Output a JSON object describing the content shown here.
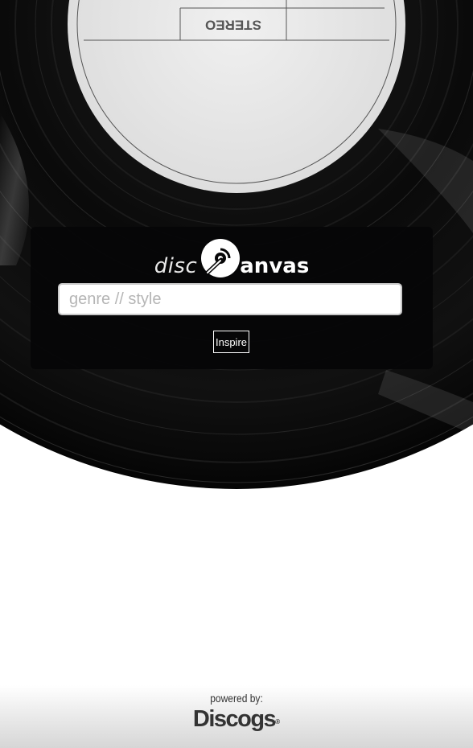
{
  "app": {
    "logo_prefix": "disc",
    "logo_suffix": "anvas"
  },
  "vinyl_label": {
    "text": "STEREO"
  },
  "search": {
    "placeholder": "genre // style",
    "value": ""
  },
  "actions": {
    "inspire_label": "Inspire"
  },
  "footer": {
    "powered_by": "powered by:",
    "brand": "Discogs",
    "registered_mark": "®"
  },
  "colors": {
    "panel_background": "#060607",
    "label_paper": "#e6e6e6",
    "vinyl": "#0b0b0c",
    "footer_text": "#333333"
  },
  "icons": {
    "logo_record": "record-icon"
  }
}
